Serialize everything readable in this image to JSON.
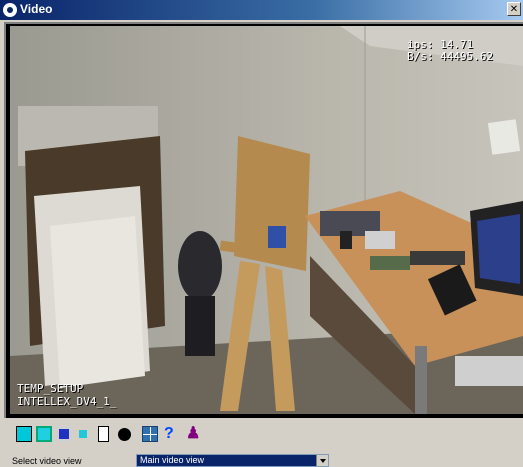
{
  "window": {
    "title": "Video"
  },
  "overlay": {
    "fps": "ips: 14.71",
    "bps": "B/s:  44495.62",
    "camera_line1": "TEMP_SETUP",
    "camera_line2": "INTELLEX_DV4_1_"
  },
  "toolbar": {
    "icons": [
      "view-cyan-icon",
      "view-cyan-small-icon",
      "view-blue-icon",
      "view-cyan-tiny-icon",
      "page-icon",
      "snapshot-icon",
      "grid-view-icon",
      "help-icon",
      "figure-icon"
    ]
  },
  "footer": {
    "select_label": "Select video view",
    "select_value": "Main video view"
  }
}
